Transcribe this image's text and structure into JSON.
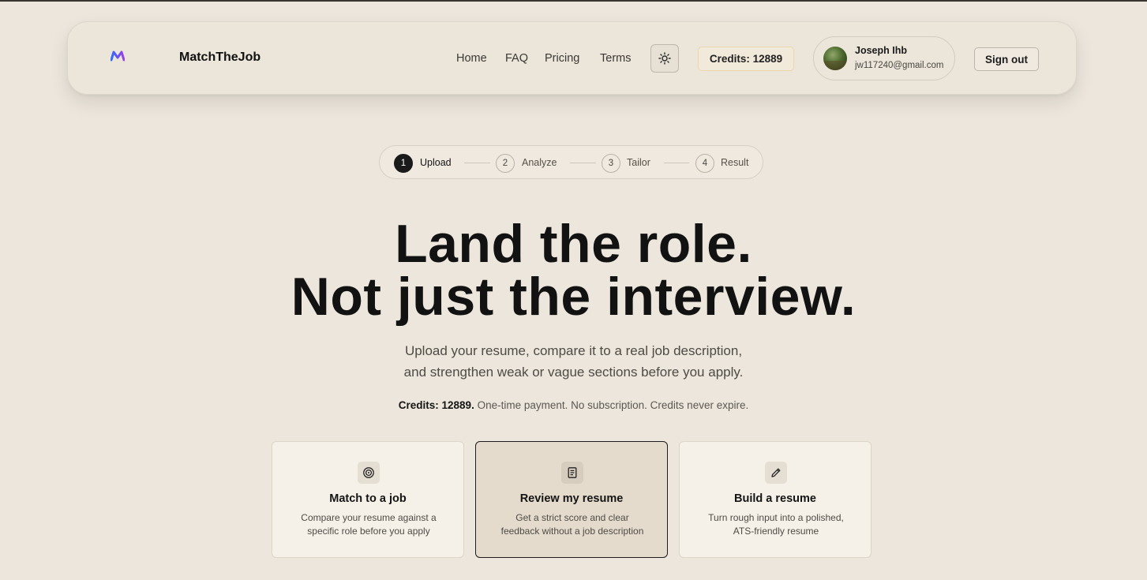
{
  "header": {
    "brand": "MatchTheJob",
    "nav": [
      "Home",
      "FAQ",
      "Pricing",
      "Terms"
    ],
    "credits_label": "Credits: 12889",
    "user": {
      "name": "Joseph Ihb",
      "email": "jw117240@gmail.com"
    },
    "signout_label": "Sign out",
    "icons": {
      "logo": "m-logo-icon",
      "theme": "sun-icon",
      "avatar": "avatar-photo"
    }
  },
  "stepper": {
    "steps": [
      {
        "number": "1",
        "label": "Upload",
        "active": true
      },
      {
        "number": "2",
        "label": "Analyze",
        "active": false
      },
      {
        "number": "3",
        "label": "Tailor",
        "active": false
      },
      {
        "number": "4",
        "label": "Result",
        "active": false
      }
    ]
  },
  "hero": {
    "title_line1": "Land the role.",
    "title_line2": "Not just the interview.",
    "subtitle_line1": "Upload your resume, compare it to a real job description,",
    "subtitle_line2": "and strengthen weak or vague sections before you apply.",
    "credits_bold": "Credits: 12889.",
    "credits_rest": " One-time payment. No subscription. Credits never expire."
  },
  "cards": [
    {
      "title": "Match to a job",
      "description": "Compare your resume against a specific role before you apply",
      "icon": "target-icon",
      "selected": false
    },
    {
      "title": "Review my resume",
      "description": "Get a strict score and clear feedback without a job description",
      "icon": "document-icon",
      "selected": true
    },
    {
      "title": "Build a resume",
      "description": "Turn rough input into a polished, ATS-friendly resume",
      "icon": "pencil-icon",
      "selected": false
    }
  ],
  "colors": {
    "background": "#ece6dc",
    "text": "#121212",
    "accent_logo_start": "#7b3fe4",
    "accent_logo_end": "#2f6bff"
  }
}
